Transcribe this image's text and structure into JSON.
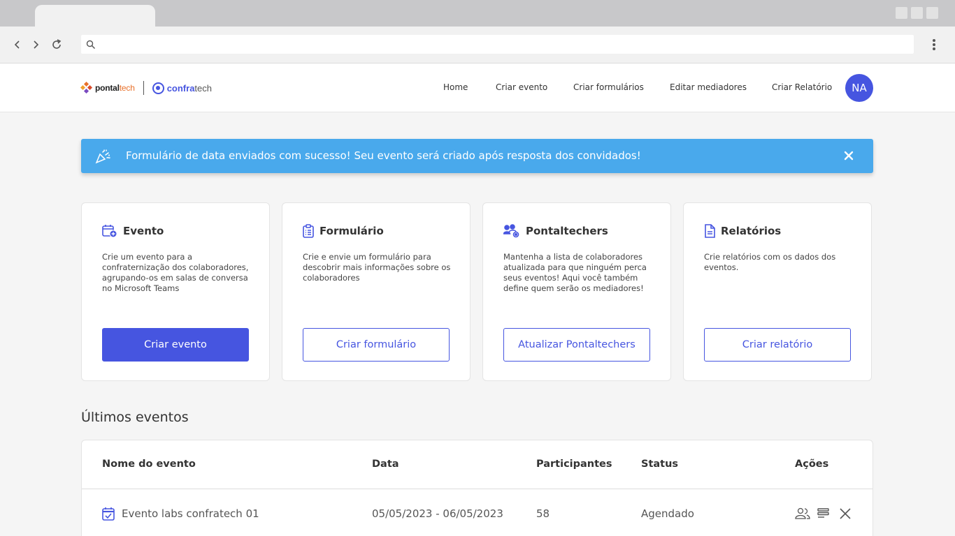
{
  "header": {
    "logo_text_pontal": "pontal",
    "logo_text_pontal_suffix": "tech",
    "logo_text_confra": "confra",
    "logo_text_confra_suffix": "tech",
    "nav": [
      {
        "label": "Home"
      },
      {
        "label": "Criar evento"
      },
      {
        "label": "Criar formulários"
      },
      {
        "label": "Editar mediadores"
      },
      {
        "label": "Criar Relatório"
      }
    ],
    "avatar_initials": "NA"
  },
  "alert": {
    "message": "Formulário de data enviados com sucesso! Seu evento será criado após resposta dos convidados!",
    "icon": "party-popper-icon",
    "close_icon": "close-icon"
  },
  "cards": [
    {
      "title": "Evento",
      "icon": "calendar-add-icon",
      "description": "Crie um evento para a confraternização dos colaboradores, agrupando-os em salas de conversa no Microsoft Teams",
      "button": "Criar evento"
    },
    {
      "title": "Formulário",
      "icon": "clipboard-icon",
      "description": "Crie e envie um formulário para descobrir mais informações sobre os colaboradores",
      "button": "Criar formulário"
    },
    {
      "title": "Pontaltechers",
      "icon": "users-gear-icon",
      "description": "Mantenha a lista de colaboradores atualizada para que ninguém perca seus eventos! Aqui você também define quem serão os mediadores!",
      "button": "Atualizar Pontaltechers"
    },
    {
      "title": "Relatórios",
      "icon": "document-icon",
      "description": "Crie relatórios com os dados dos eventos.",
      "button": "Criar relatório"
    }
  ],
  "events": {
    "section_title": "Últimos eventos",
    "columns": [
      "Nome do evento",
      "Data",
      "Participantes",
      "Status",
      "Ações"
    ],
    "rows": [
      {
        "name": "Evento labs confratech 01",
        "date": "05/05/2023 - 06/05/2023",
        "participants": "58",
        "status": "Agendado"
      }
    ]
  },
  "colors": {
    "primary": "#4655e0",
    "alert_bg": "#49a9ec",
    "page_bg": "#f5f5f5"
  }
}
